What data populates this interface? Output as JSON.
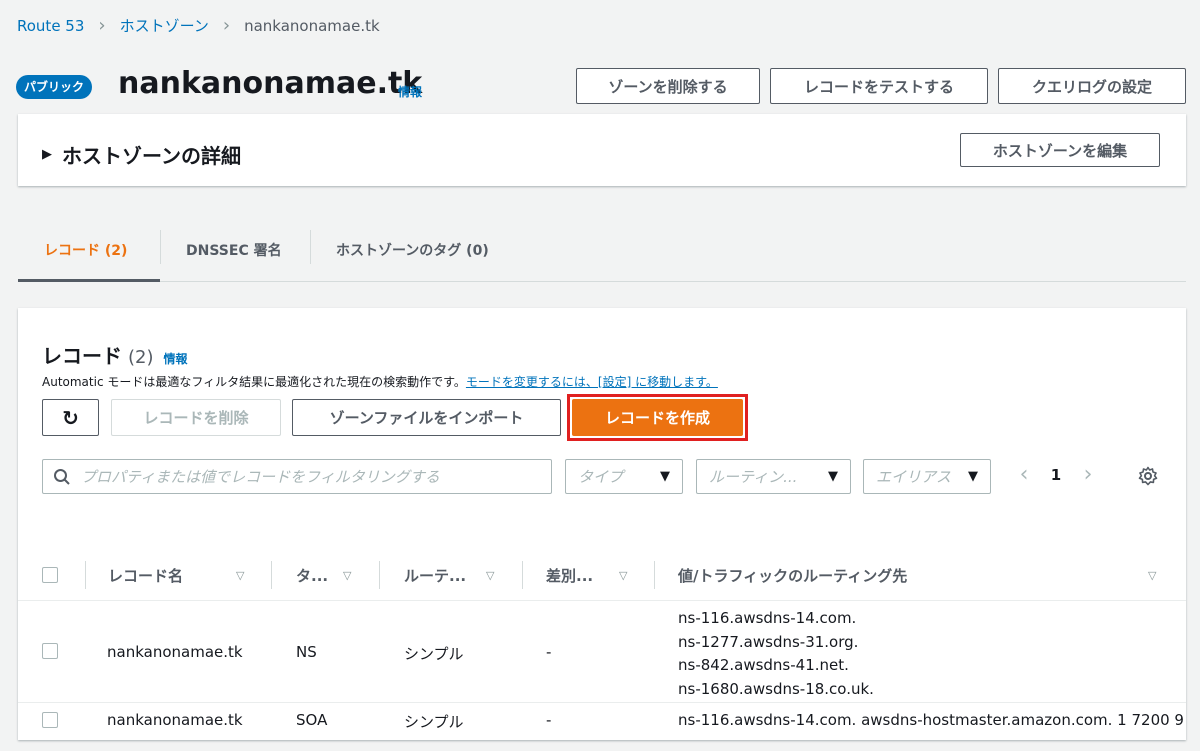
{
  "breadcrumb": {
    "root": "Route 53",
    "parent": "ホストゾーン",
    "current": "nankanonamae.tk"
  },
  "header": {
    "badge": "パブリック",
    "title": "nankanonamae.tk",
    "info": "情報",
    "buttons": {
      "delete_zone": "ゾーンを削除する",
      "test_record": "レコードをテストする",
      "query_log": "クエリログの設定"
    }
  },
  "details": {
    "label": "ホストゾーンの詳細",
    "edit_button": "ホストゾーンを編集"
  },
  "tabs": [
    {
      "label": "レコード (2)"
    },
    {
      "label": "DNSSEC 署名"
    },
    {
      "label": "ホストゾーンのタグ (0)"
    }
  ],
  "records": {
    "title": "レコード",
    "count": "(2)",
    "info": "情報",
    "description": "Automatic モードは最適なフィルタ結果に最適化された現在の検索動作です。",
    "description_link": "モードを変更するには、[設定] に移動します。",
    "buttons": {
      "delete": "レコードを削除",
      "import": "ゾーンファイルをインポート",
      "create": "レコードを作成"
    },
    "search_placeholder": "プロパティまたは値でレコードをフィルタリングする",
    "filters": {
      "type": "タイプ",
      "routing": "ルーティン...",
      "alias": "エイリアス"
    },
    "page": "1"
  },
  "table": {
    "columns": [
      "レコード名",
      "タ...",
      "ルーテ...",
      "差別...",
      "値/トラフィックのルーティング先"
    ],
    "rows": [
      {
        "name": "nankanonamae.tk",
        "type": "NS",
        "routing": "シンプル",
        "diff": "-",
        "values": [
          "ns-116.awsdns-14.com.",
          "ns-1277.awsdns-31.org.",
          "ns-842.awsdns-41.net.",
          "ns-1680.awsdns-18.co.uk."
        ]
      },
      {
        "name": "nankanonamae.tk",
        "type": "SOA",
        "routing": "シンプル",
        "diff": "-",
        "values": [
          "ns-116.awsdns-14.com. awsdns-hostmaster.amazon.com. 1 7200 9"
        ]
      }
    ]
  },
  "colors": {
    "link": "#0073bb",
    "accent": "#ec7211",
    "highlight": "#e02020"
  }
}
